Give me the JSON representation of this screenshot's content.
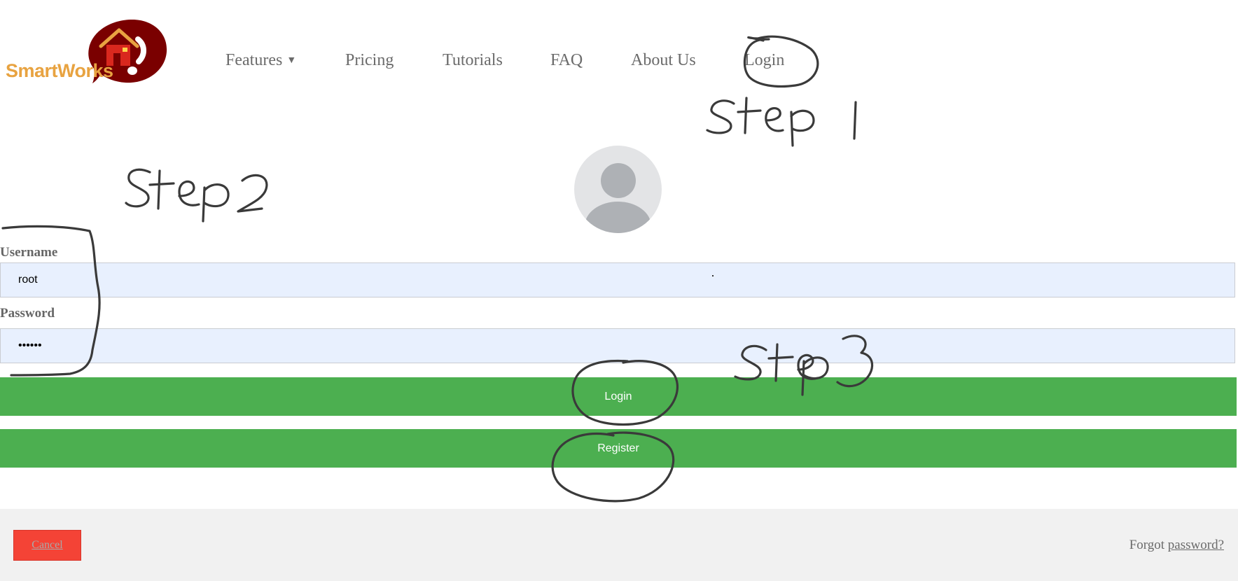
{
  "brand": {
    "name": "SmartWorks"
  },
  "nav": {
    "items": [
      {
        "label": "Features",
        "has_dropdown": true
      },
      {
        "label": "Pricing"
      },
      {
        "label": "Tutorials"
      },
      {
        "label": "FAQ"
      },
      {
        "label": "About Us"
      },
      {
        "label": "Login"
      }
    ],
    "caret": "▼"
  },
  "form": {
    "avatar_icon": "user-avatar-icon",
    "username_label": "Username",
    "username_value": "root",
    "password_label": "Password",
    "password_value": "••••••",
    "login_label": "Login",
    "register_label": "Register"
  },
  "footer": {
    "cancel_label": "Cancel",
    "forgot_prefix": "Forgot",
    "forgot_link": "password?"
  },
  "colors": {
    "brand_orange": "#e8a341",
    "logo_red": "#7a0000",
    "button_green": "#4caf50",
    "cancel_red": "#f44336",
    "input_bg": "#e8f0fe",
    "footer_bg": "#f1f1f1"
  },
  "annotations": {
    "step1": "Step 1",
    "step2": "Step 2",
    "step3": "Step 3"
  }
}
